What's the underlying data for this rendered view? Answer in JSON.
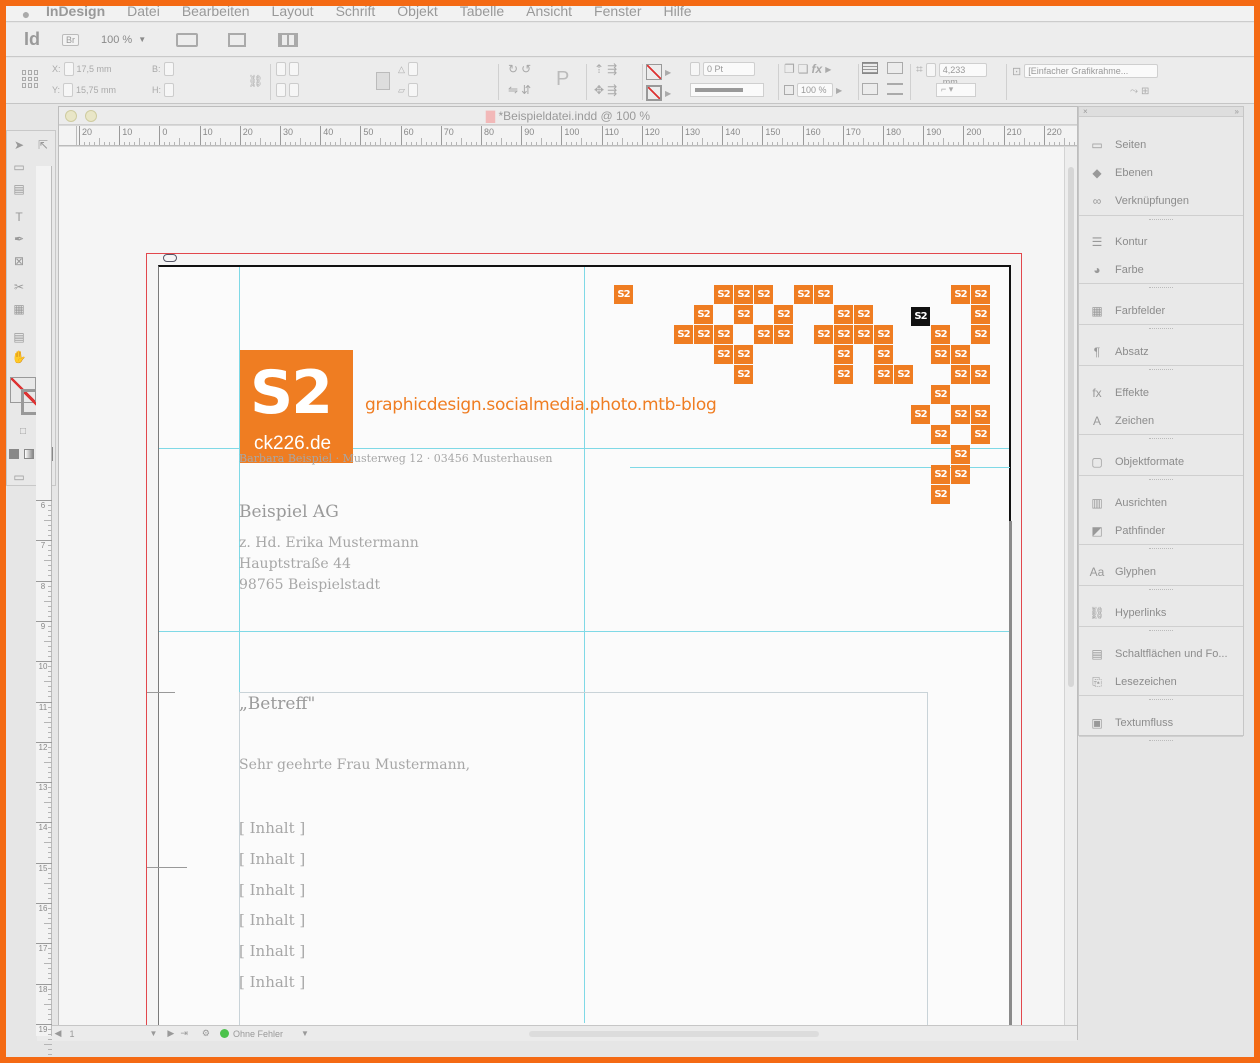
{
  "menubar": {
    "apple": "",
    "app": "InDesign",
    "items": [
      "Datei",
      "Bearbeiten",
      "Layout",
      "Schrift",
      "Objekt",
      "Tabelle",
      "Ansicht",
      "Fenster",
      "Hilfe"
    ]
  },
  "appbar": {
    "app_logo": "Id",
    "bridge": "Br",
    "zoom": "100 %"
  },
  "control": {
    "x_label": "X:",
    "x_value": "17,5 mm",
    "y_label": "Y:",
    "y_value": "15,75 mm",
    "w_label": "B:",
    "h_label": "H:",
    "stroke_weight": "0 Pt",
    "opacity": "100 %",
    "dimension": "4,233 mm",
    "frame_style": "[Einfacher Grafikrahme..."
  },
  "document": {
    "title": "*Beispieldatei.indd @ 100 %",
    "ruler_ticks": [
      "20",
      "10",
      "0",
      "10",
      "20",
      "30",
      "40",
      "50",
      "60",
      "70",
      "80",
      "90",
      "100",
      "110",
      "120",
      "130",
      "140",
      "150",
      "160",
      "170",
      "180",
      "190",
      "200",
      "210",
      "220"
    ],
    "vruler_ticks": [
      "6",
      "7",
      "8",
      "9",
      "10",
      "11",
      "12",
      "13",
      "14",
      "15",
      "16",
      "17",
      "18",
      "19"
    ]
  },
  "letter": {
    "logo_glyph": "S2",
    "logo_domain": "ck226.de",
    "tagline": "graphicdesign.socialmedia.photo.mtb-blog",
    "sender_line": "Barbara Beispiel · Musterweg 12 · 03456 Musterhausen",
    "recipient_company": "Beispiel AG",
    "recipient_attn": "z. Hd. Erika Mustermann",
    "recipient_street": "Hauptstraße 44",
    "recipient_city": "98765 Beispielstadt",
    "subject": "„Betreff\"",
    "salutation": "Sehr geehrte Frau Mustermann,",
    "content_lines": [
      "[ Inhalt ]",
      "[ Inhalt ]",
      "[ Inhalt ]",
      "[ Inhalt ]",
      "[ Inhalt ]",
      "[ Inhalt ]"
    ],
    "pixel_glyph": "S2"
  },
  "status": {
    "page": "1",
    "preflight": "Ohne Fehler"
  },
  "panels": [
    {
      "label": "Seiten",
      "icon": "pages-icon"
    },
    {
      "label": "Ebenen",
      "icon": "layers-icon"
    },
    {
      "label": "Verknüpfungen",
      "icon": "links-icon"
    },
    {
      "label": "Kontur",
      "icon": "stroke-icon"
    },
    {
      "label": "Farbe",
      "icon": "color-icon"
    },
    {
      "label": "Farbfelder",
      "icon": "swatches-icon"
    },
    {
      "label": "Absatz",
      "icon": "paragraph-icon"
    },
    {
      "label": "Effekte",
      "icon": "effects-icon"
    },
    {
      "label": "Zeichen",
      "icon": "character-icon"
    },
    {
      "label": "Objektformate",
      "icon": "object-styles-icon"
    },
    {
      "label": "Ausrichten",
      "icon": "align-icon"
    },
    {
      "label": "Pathfinder",
      "icon": "pathfinder-icon"
    },
    {
      "label": "Glyphen",
      "icon": "glyphs-icon"
    },
    {
      "label": "Hyperlinks",
      "icon": "hyperlinks-icon"
    },
    {
      "label": "Schaltflächen und Fo...",
      "icon": "buttons-icon"
    },
    {
      "label": "Lesezeichen",
      "icon": "bookmarks-icon"
    },
    {
      "label": "Textumfluss",
      "icon": "text-wrap-icon"
    }
  ],
  "colors": {
    "accent": "#ef7d22",
    "frame": "#f46a14",
    "guide": "#7fd9e6"
  }
}
